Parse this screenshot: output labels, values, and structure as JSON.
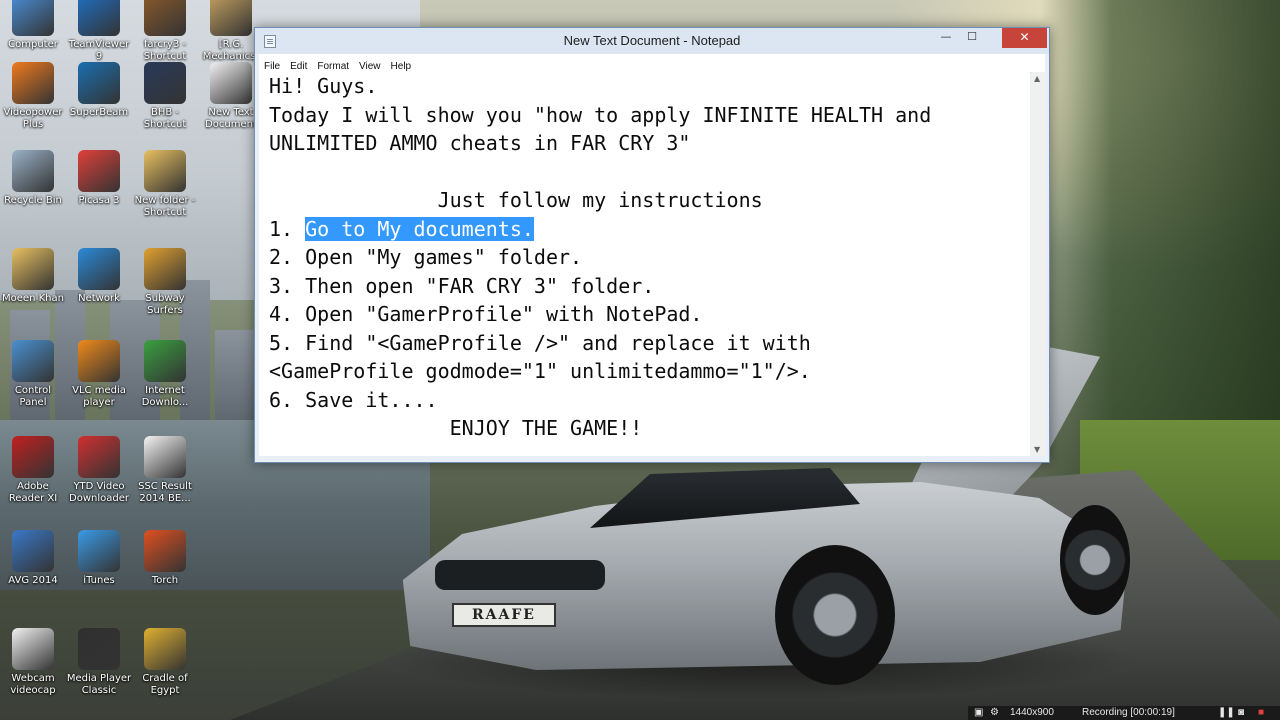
{
  "desktop": {
    "icons": [
      {
        "label": "Computer",
        "color": "#4a8fd8"
      },
      {
        "label": "TeamViewer\n9",
        "color": "#1f6fc4"
      },
      {
        "label": "farcry3 -\nShortcut",
        "color": "#8a5a2a"
      },
      {
        "label": "[R.G.\nMechanics]",
        "color": "#c4a060"
      },
      {
        "label": "Videopower\nPlus",
        "color": "#f07a1e"
      },
      {
        "label": "SuperBeam",
        "color": "#1a6fb0"
      },
      {
        "label": "BHB -\nShortcut",
        "color": "#2a3a5a"
      },
      {
        "label": "New Text\nDocument",
        "color": "#f2f2f2"
      },
      {
        "label": "Recycle Bin",
        "color": "#9bb2c8"
      },
      {
        "label": "Picasa 3",
        "color": "#e0403a"
      },
      {
        "label": "New folder -\nShortcut",
        "color": "#e8c060"
      },
      {
        "label": "Moeen Khan",
        "color": "#e8c060"
      },
      {
        "label": "Network",
        "color": "#2a8ad8"
      },
      {
        "label": "Subway\nSurfers",
        "color": "#e0a030"
      },
      {
        "label": "Control\nPanel",
        "color": "#4a90d0"
      },
      {
        "label": "VLC media\nplayer",
        "color": "#f08a1a"
      },
      {
        "label": "Internet\nDownlo...",
        "color": "#3aa040"
      },
      {
        "label": "Adobe\nReader XI",
        "color": "#c02020"
      },
      {
        "label": "YTD Video\nDownloader",
        "color": "#d03030"
      },
      {
        "label": "SSC Result\n2014 BE...",
        "color": "#f4f4f4"
      },
      {
        "label": "AVG 2014",
        "color": "#3a78c8"
      },
      {
        "label": "iTunes",
        "color": "#3a9ae8"
      },
      {
        "label": "Torch",
        "color": "#e05020"
      },
      {
        "label": "Webcam\nvideocap",
        "color": "#f2f2f2"
      },
      {
        "label": "Media Player\nClassic",
        "color": "#303030"
      },
      {
        "label": "Cradle of\nEgypt",
        "color": "#e0b030"
      }
    ],
    "plate_text": "RAAFE"
  },
  "window": {
    "title": "New Text Document - Notepad",
    "controls": {
      "minimize": "—",
      "maximize": "☐",
      "close": "✕"
    },
    "menu": [
      "File",
      "Edit",
      "Format",
      "View",
      "Help"
    ],
    "lines": [
      {
        "text": "Hi! Guys."
      },
      {
        "text": "Today I will show you \"how to apply INFINITE HEALTH and"
      },
      {
        "text": "UNLIMITED AMMO cheats in FAR CRY 3\""
      },
      {
        "text": ""
      },
      {
        "text": "              Just follow my instructions"
      },
      {
        "prefix": "1. ",
        "selected": "Go to My documents.",
        "text": ""
      },
      {
        "text": "2. Open \"My games\" folder."
      },
      {
        "text": "3. Then open \"FAR CRY 3\" folder."
      },
      {
        "text": "4. Open \"GamerProfile\" with NotePad."
      },
      {
        "text": "5. Find \"<GameProfile />\" and replace it with"
      },
      {
        "text": "<GameProfile godmode=\"1\" unlimitedammo=\"1\"/>."
      },
      {
        "text": "6. Save it...."
      },
      {
        "text": "               ENJOY THE GAME!!"
      }
    ]
  },
  "recorder": {
    "resolution": "1440x900",
    "status": "Recording [00:00:19]"
  }
}
